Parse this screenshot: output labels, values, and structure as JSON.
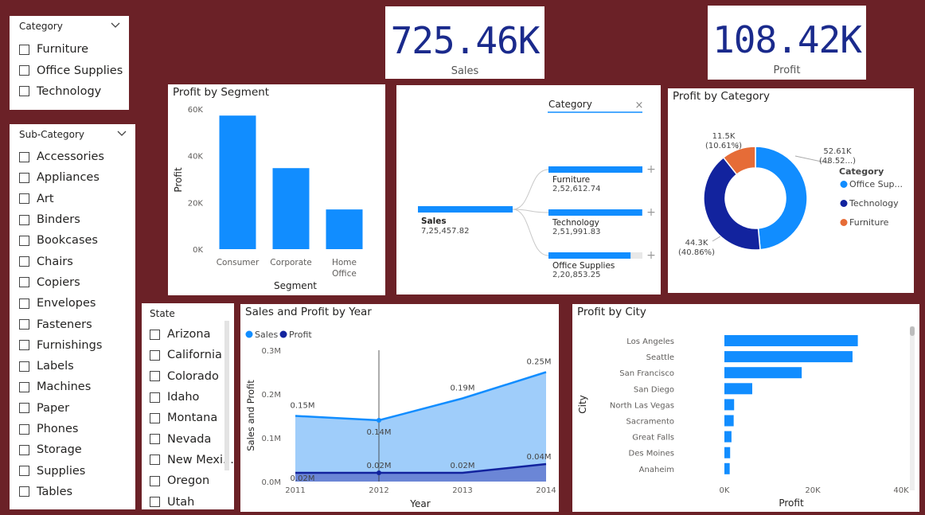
{
  "category_slicer": {
    "title": "Category",
    "items": [
      "Furniture",
      "Office Supplies",
      "Technology"
    ]
  },
  "subcategory_slicer": {
    "title": "Sub-Category",
    "items": [
      "Accessories",
      "Appliances",
      "Art",
      "Binders",
      "Bookcases",
      "Chairs",
      "Copiers",
      "Envelopes",
      "Fasteners",
      "Furnishings",
      "Labels",
      "Machines",
      "Paper",
      "Phones",
      "Storage",
      "Supplies",
      "Tables"
    ]
  },
  "state_slicer": {
    "title": "State",
    "items": [
      "Arizona",
      "California",
      "Colorado",
      "Idaho",
      "Montana",
      "Nevada",
      "New Mexi...",
      "Oregon",
      "Utah"
    ]
  },
  "kpi_sales": {
    "value": "725.46K",
    "label": "Sales"
  },
  "kpi_profit": {
    "value": "108.42K",
    "label": "Profit"
  },
  "colors": {
    "background": "#6b2127",
    "primary": "#118dff",
    "dark": "#12239e",
    "orange": "#e66c37",
    "kpi_text": "#1a2a8c",
    "area_light": "#9fcdfa",
    "area_dark": "#6b86d6"
  },
  "decomposition_tree": {
    "filter_label": "Category",
    "root": {
      "name": "Sales",
      "value": "7,25,457.82"
    },
    "children": [
      {
        "name": "Furniture",
        "value": "2,52,612.74",
        "share": 1.0
      },
      {
        "name": "Technology",
        "value": "2,51,991.83",
        "share": 0.998
      },
      {
        "name": "Office Supplies",
        "value": "2,20,853.25",
        "share": 0.874
      }
    ],
    "expand_symbol": "+",
    "close_symbol": "×"
  },
  "chart_data": [
    {
      "type": "bar",
      "title": "Profit by Segment",
      "categories": [
        "Consumer",
        "Corporate",
        "Home Office"
      ],
      "values": [
        57200,
        34700,
        17000
      ],
      "xlabel": "Segment",
      "ylabel": "Profit",
      "ylim": [
        0,
        60000
      ],
      "yticks": [
        {
          "v": 0,
          "label": "0K"
        },
        {
          "v": 20000,
          "label": "20K"
        },
        {
          "v": 40000,
          "label": "40K"
        },
        {
          "v": 60000,
          "label": "60K"
        }
      ]
    },
    {
      "type": "pie",
      "title": "Profit by Category",
      "legend_title": "Category",
      "categories": [
        "Office Sup...",
        "Technology",
        "Furniture"
      ],
      "values": [
        52610,
        44300,
        11500
      ],
      "labels": [
        {
          "value": "52.61K",
          "pct": "(48.52...)"
        },
        {
          "value": "44.3K",
          "pct": "(40.86%)"
        },
        {
          "value": "11.5K",
          "pct": "(10.61%)"
        }
      ],
      "legend_position": "right"
    },
    {
      "type": "area",
      "title": "Sales and Profit by Year",
      "x": [
        2011,
        2012,
        2013,
        2014
      ],
      "series": [
        {
          "name": "Sales",
          "values": [
            0.15,
            0.14,
            0.19,
            0.25
          ],
          "labels": [
            "0.15M",
            "0.14M",
            "0.19M",
            "0.25M"
          ]
        },
        {
          "name": "Profit",
          "values": [
            0.02,
            0.02,
            0.02,
            0.04
          ],
          "labels": [
            "0.02M",
            "0.02M",
            "0.02M",
            "0.04M"
          ]
        }
      ],
      "xlabel": "Year",
      "ylabel": "Sales and Profit",
      "ylim": [
        0,
        0.3
      ],
      "yticks": [
        {
          "v": 0,
          "label": "0.0M"
        },
        {
          "v": 0.1,
          "label": "0.1M"
        },
        {
          "v": 0.2,
          "label": "0.2M"
        },
        {
          "v": 0.3,
          "label": "0.3M"
        }
      ],
      "legend_position": "top-left"
    },
    {
      "type": "bar",
      "orientation": "horizontal",
      "title": "Profit by City",
      "categories": [
        "Los Angeles",
        "Seattle",
        "San Francisco",
        "San Diego",
        "North Las Vegas",
        "Sacramento",
        "Great Falls",
        "Des Moines",
        "Anaheim"
      ],
      "values": [
        30200,
        29000,
        17500,
        6300,
        2200,
        2100,
        1600,
        1300,
        1200
      ],
      "xlabel": "Profit",
      "ylabel": "City",
      "xlim": [
        0,
        40000
      ],
      "xticks": [
        {
          "v": 0,
          "label": "0K"
        },
        {
          "v": 20000,
          "label": "20K"
        },
        {
          "v": 40000,
          "label": "40K"
        }
      ]
    }
  ]
}
